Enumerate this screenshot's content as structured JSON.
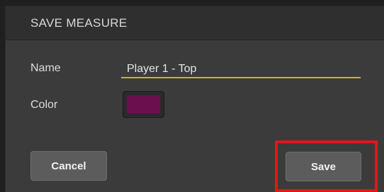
{
  "dialog": {
    "title": "SAVE MEASURE",
    "name_label": "Name",
    "name_value": "Player 1 - Top",
    "color_label": "Color",
    "color_value": "#6b0f4e",
    "cancel_label": "Cancel",
    "save_label": "Save",
    "highlight_color": "#e5141b",
    "input_accent_color": "#e3a52b"
  }
}
